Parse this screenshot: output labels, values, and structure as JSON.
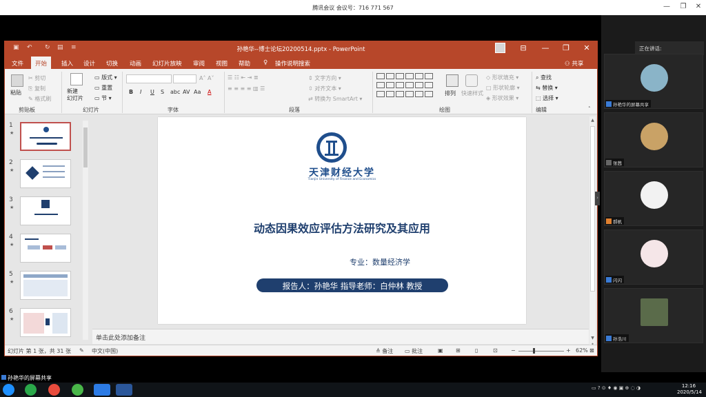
{
  "meeting": {
    "title": "腾讯会议 会议号：716 771 567",
    "controls": [
      "—",
      "❐",
      "✕"
    ],
    "share_label": "孙艳华的屏幕共享",
    "speaking_label": "正在讲话:",
    "participants": [
      {
        "name": "孙艳华的屏幕共享",
        "avatar_color": "#8ab4c8"
      },
      {
        "name": "张茜",
        "avatar_color": "#c9a266"
      },
      {
        "name": "郝帆",
        "avatar_color": "#f2f2f2"
      },
      {
        "name": "闪闪",
        "avatar_color": "#f5e6e8"
      },
      {
        "name": "孙浩川",
        "avatar_color": "#5a6b4a"
      }
    ]
  },
  "ppt": {
    "doc_title": "孙艳华--博士论坛20200514.pptx  -  PowerPoint",
    "title_controls": [
      "⊟",
      "—",
      "❐",
      "✕"
    ],
    "tabs": [
      "文件",
      "开始",
      "插入",
      "设计",
      "切换",
      "动画",
      "幻灯片放映",
      "审阅",
      "视图",
      "帮助"
    ],
    "active_tab": "开始",
    "tell_me": "操作说明搜索",
    "share": "共享",
    "ribbon": {
      "clipboard": {
        "paste": "粘贴",
        "cut": "剪切",
        "copy": "复制",
        "format_painter": "格式刷",
        "label": "剪贴板"
      },
      "slides": {
        "new_slide": "新建\n幻灯片",
        "layout": "版式",
        "reset": "重置",
        "section": "节",
        "label": "幻灯片"
      },
      "font": {
        "label": "字体",
        "bold": "B",
        "italic": "I",
        "underline": "U",
        "strike": "S",
        "shadow": "abc",
        "spacing": "AV",
        "case": "Aa",
        "color": "A"
      },
      "paragraph": {
        "label": "段落",
        "text_direction": "文字方向",
        "align_text": "对齐文本",
        "smartart": "转换为 SmartArt"
      },
      "drawing": {
        "label": "绘图",
        "arrange": "排列",
        "quick_styles": "快速样式",
        "fill": "形状填充",
        "outline": "形状轮廓",
        "effects": "形状效果"
      },
      "editing": {
        "label": "编辑",
        "find": "查找",
        "replace": "替换",
        "select": "选择"
      }
    },
    "slide_numbers": [
      "1",
      "2",
      "3",
      "4",
      "5",
      "6"
    ],
    "slide": {
      "uni_cn": "天津财经大学",
      "uni_en": "Tianjin University of Finance and Economics",
      "title": "动态因果效应评估方法研究及其应用",
      "major": "专业：数量经济学",
      "reporter": "报告人：孙艳华     指导老师：白仲林  教授"
    },
    "notes_placeholder": "单击此处添加备注",
    "status": {
      "slide_info": "幻灯片 第 1 张，共 31 张",
      "language": "中文(中国)",
      "notes_btn": "备注",
      "comments_btn": "批注",
      "zoom": "62%"
    }
  },
  "taskbar": {
    "time": "12:16",
    "date": "2020/5/14"
  },
  "colors": {
    "ppt_accent": "#b7472a",
    "slide_blue": "#1f3f6e"
  }
}
